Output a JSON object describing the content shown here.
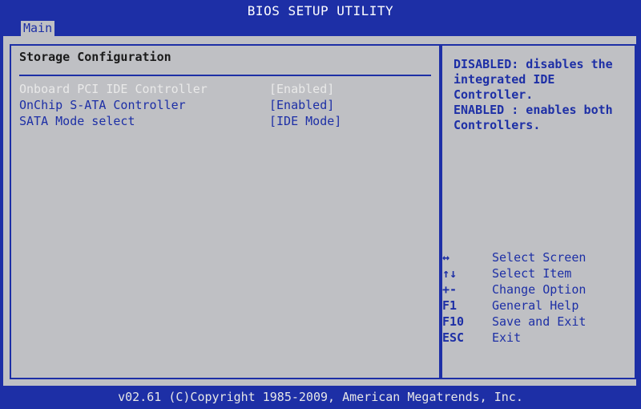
{
  "window": {
    "title": "BIOS SETUP UTILITY"
  },
  "menu": {
    "tabs": [
      {
        "label": "Main",
        "selected": true
      }
    ]
  },
  "main_panel": {
    "section_title": "Storage Configuration",
    "settings": [
      {
        "label": "Onboard PCI IDE Controller",
        "value": "[Enabled]",
        "highlighted": true
      },
      {
        "label": "OnChip S-ATA Controller",
        "value": "[Enabled]",
        "highlighted": false
      },
      {
        "label": "SATA Mode select",
        "value": "[IDE Mode]",
        "highlighted": false
      }
    ]
  },
  "help_panel": {
    "text": "DISABLED: disables the integrated IDE Controller.\nENABLED : enables both Controllers."
  },
  "key_legend": [
    {
      "key": "↔",
      "action": "Select Screen"
    },
    {
      "key": "↑↓",
      "action": "Select Item"
    },
    {
      "key": "+-",
      "action": "Change Option"
    },
    {
      "key": "F1",
      "action": "General Help"
    },
    {
      "key": "F10",
      "action": "Save and Exit"
    },
    {
      "key": "ESC",
      "action": "Exit"
    }
  ],
  "footer": {
    "text": "v02.61 (C)Copyright 1985-2009, American Megatrends, Inc."
  },
  "colors": {
    "background": "#1d2fa6",
    "panel": "#bfc0c4",
    "highlight_text": "#e9e9e9"
  }
}
